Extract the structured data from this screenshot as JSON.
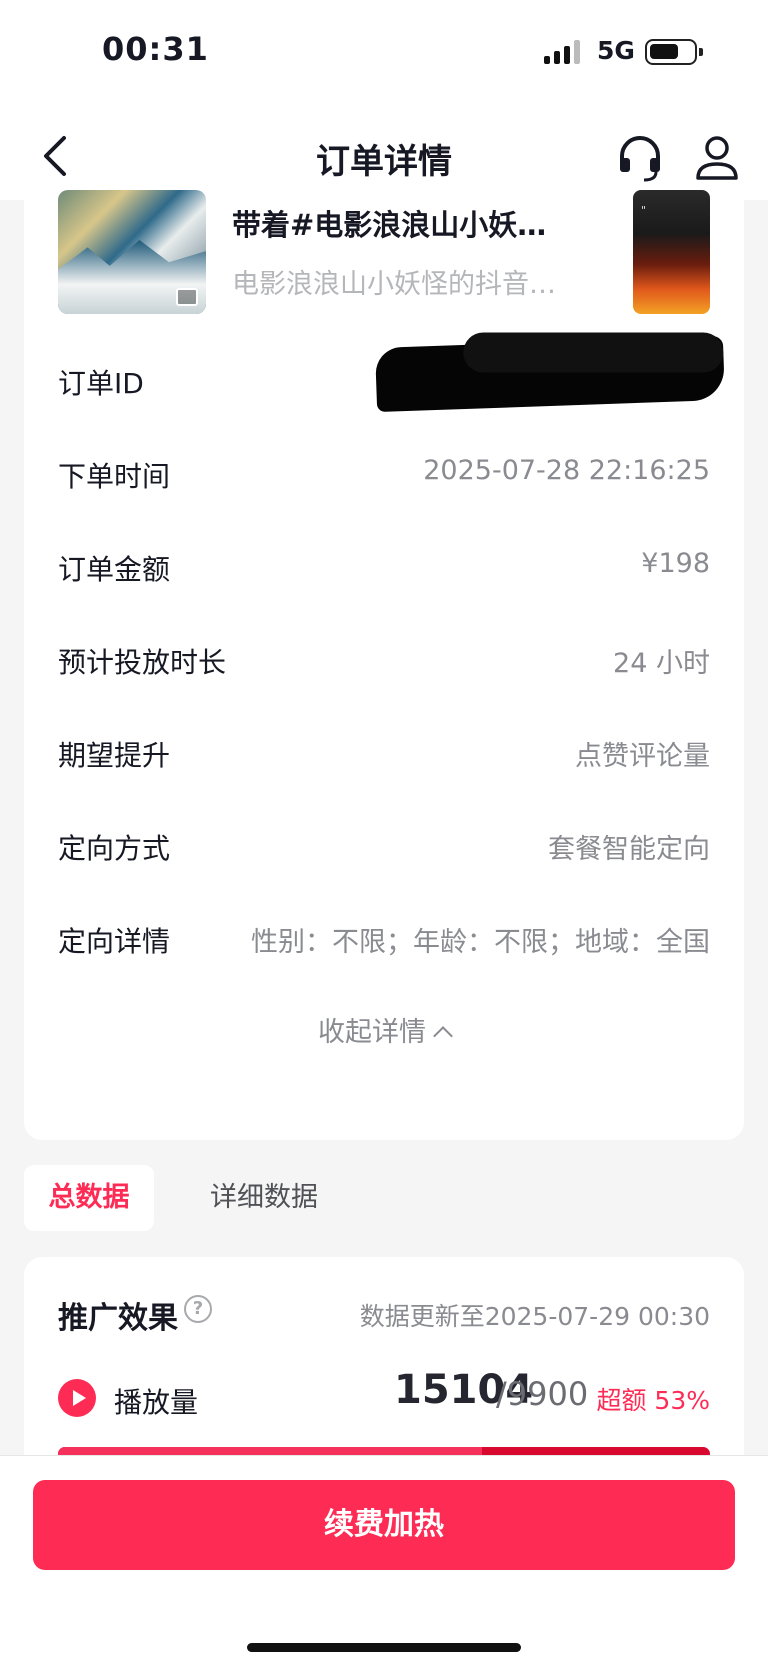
{
  "status_bar": {
    "time": "00:31",
    "network": "5G"
  },
  "nav": {
    "title": "订单详情"
  },
  "video": {
    "title": "带着#电影浪浪山小妖…",
    "subtitle": "电影浪浪山小妖怪的抖音…"
  },
  "order": {
    "rows": [
      {
        "label": "订单ID",
        "value": ""
      },
      {
        "label": "下单时间",
        "value": "2025-07-28 22:16:25"
      },
      {
        "label": "订单金额",
        "value": "¥198"
      },
      {
        "label": "预计投放时长",
        "value": "24 小时"
      },
      {
        "label": "期望提升",
        "value": "点赞评论量"
      },
      {
        "label": "定向方式",
        "value": "套餐智能定向"
      },
      {
        "label": "定向详情",
        "value": "性别：不限；年龄：不限；地域：全国"
      }
    ],
    "collapse_label": "收起详情"
  },
  "tabs": [
    {
      "label": "总数据",
      "active": true
    },
    {
      "label": "详细数据",
      "active": false
    }
  ],
  "effect": {
    "title": "推广效果",
    "updated": "数据更新至2025-07-29 00:30",
    "metric": {
      "label": "播放量",
      "value": "15104",
      "target": "/9900",
      "over": "超额 53%",
      "progress_fraction": 0.65
    }
  },
  "actions": {
    "renew_label": "续费加热"
  },
  "colors": {
    "accent": "#fe2c55",
    "text": "#161823",
    "muted": "#8a8b91"
  }
}
